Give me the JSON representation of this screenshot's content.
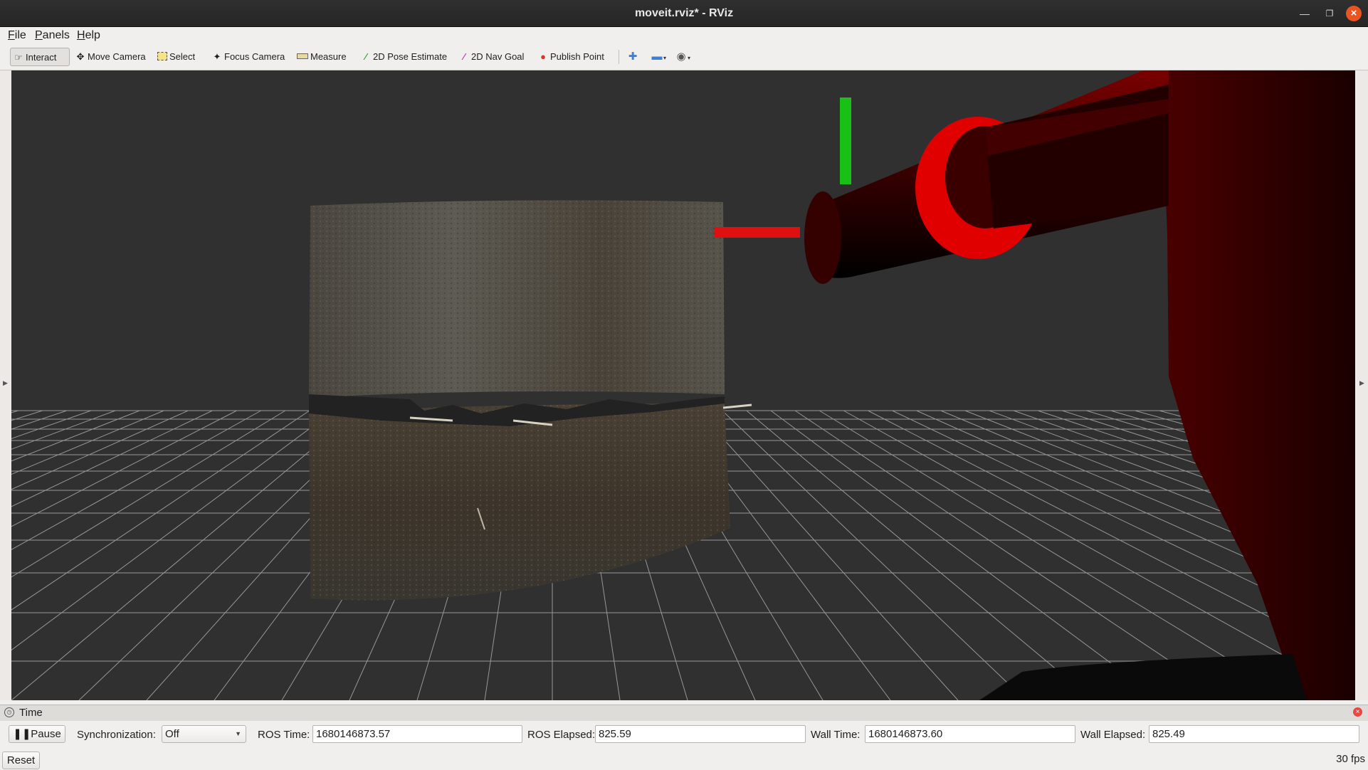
{
  "window": {
    "title": "moveit.rviz* - RViz"
  },
  "menu": [
    "File",
    "Panels",
    "Help"
  ],
  "toolbar": {
    "tools": [
      {
        "label": "Interact",
        "icon": "hand-icon",
        "active": true
      },
      {
        "label": "Move Camera",
        "icon": "move-camera-icon",
        "active": false
      },
      {
        "label": "Select",
        "icon": "select-icon",
        "active": false
      },
      {
        "label": "Focus Camera",
        "icon": "focus-camera-icon",
        "active": false
      },
      {
        "label": "Measure",
        "icon": "ruler-icon",
        "active": false
      },
      {
        "label": "2D Pose Estimate",
        "icon": "green-arrow-icon",
        "active": false
      },
      {
        "label": "2D Nav Goal",
        "icon": "pink-arrow-icon",
        "active": false
      },
      {
        "label": "Publish Point",
        "icon": "map-pin-icon",
        "active": false
      }
    ],
    "extra_buttons": [
      "add-tool-icon",
      "remove-tool-icon",
      "view-eye-icon"
    ]
  },
  "time_panel": {
    "title": "Time",
    "pause_label": "Pause",
    "sync_label": "Synchronization:",
    "sync_value": "Off",
    "ros_time_label": "ROS Time:",
    "ros_time": "1680146873.57",
    "ros_elapsed_label": "ROS Elapsed:",
    "ros_elapsed": "825.59",
    "wall_time_label": "Wall Time:",
    "wall_time": "1680146873.60",
    "wall_elapsed_label": "Wall Elapsed:",
    "wall_elapsed": "825.49"
  },
  "status": {
    "reset_label": "Reset",
    "fps": "30 fps"
  },
  "colors": {
    "background": "#303030",
    "grid": "#a9a9a9",
    "axis_x": "#e01010",
    "axis_y": "#10c010",
    "robot_link": "#6a0000",
    "robot_ring": "#dd0000"
  }
}
